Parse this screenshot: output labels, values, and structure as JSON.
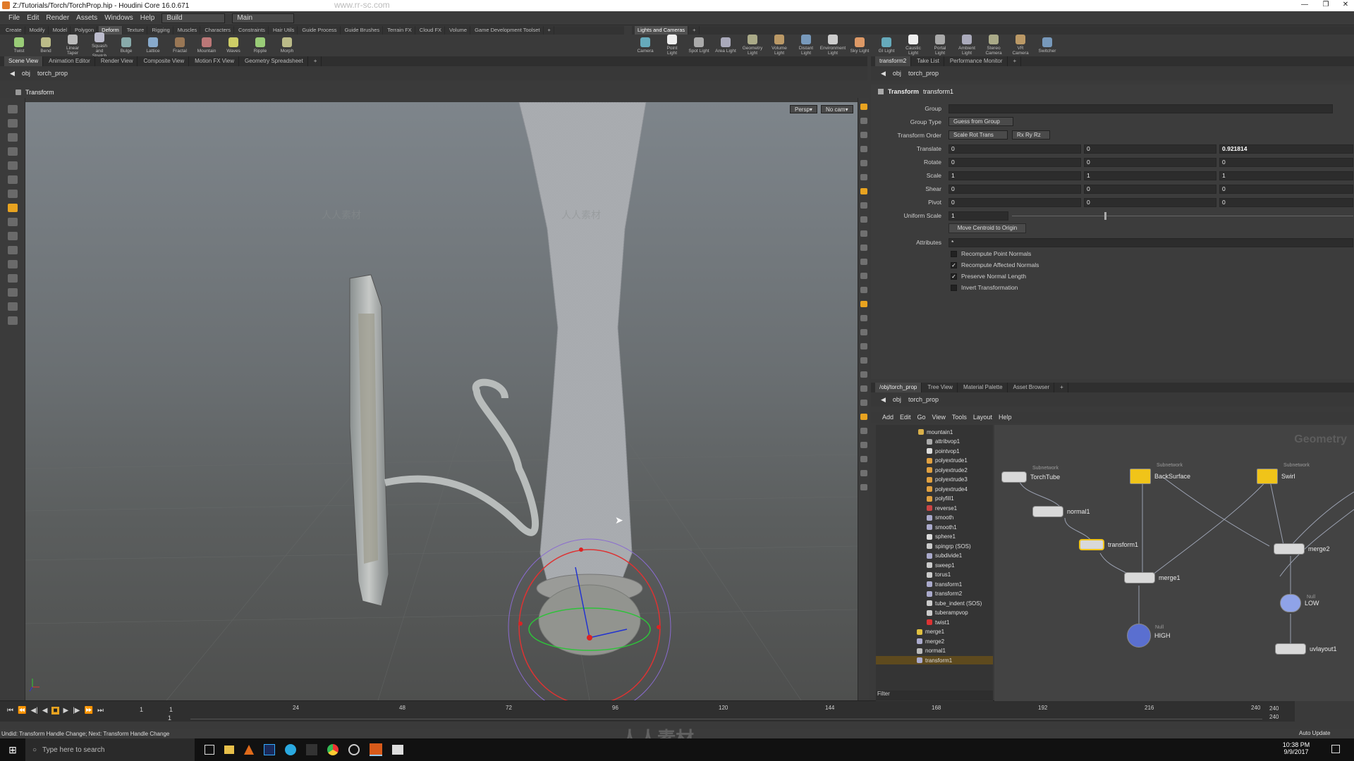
{
  "window": {
    "title": "Z:/Tutorials/Torch/TorchProp.hip - Houdini Core 16.0.671",
    "watermark": "www.rr-sc.com",
    "watermark2": "人人素材"
  },
  "menu": {
    "items": [
      "File",
      "Edit",
      "Render",
      "Assets",
      "Windows",
      "Help"
    ],
    "desktop": "Build",
    "pane_mode": "Main"
  },
  "shelf_tabs_left": [
    "Create",
    "Modify",
    "Model",
    "Polygon",
    "Deform",
    "Texture",
    "Rigging",
    "Muscles",
    "Characters",
    "Constraints",
    "Hair Utils",
    "Guide Process",
    "Guide Brushes",
    "Terrain FX",
    "Cloud FX",
    "Volume",
    "Game Development Toolset"
  ],
  "shelf_tabs_left_active": "Deform",
  "shelf_tools_left": [
    "Twist",
    "Bend",
    "Linear Taper",
    "Squash and Stretch",
    "Bulge",
    "Lattice",
    "Fractal",
    "Mountain",
    "Waves",
    "Ripple",
    "Morph"
  ],
  "shelf_tabs_right": [
    "Lights and Cameras"
  ],
  "shelf_tools_right": [
    "Camera",
    "Point Light",
    "Spot Light",
    "Area Light",
    "Geometry Light",
    "Volume Light",
    "Distant Light",
    "Environment Light",
    "Sky Light",
    "GI Light",
    "Caustic Light",
    "Portal Light",
    "Ambient Light",
    "Stereo Camera",
    "VR Camera",
    "Switcher"
  ],
  "viewport": {
    "tabs": [
      "Scene View",
      "Animation Editor",
      "Render View",
      "Composite View",
      "Motion FX View",
      "Geometry Spreadsheet"
    ],
    "path": {
      "obj": "obj",
      "node": "torch_prop"
    },
    "tool_label": "Transform",
    "persp": "Persp",
    "cam": "No cam"
  },
  "timeline": {
    "current": "1",
    "start": "1",
    "end": "240",
    "end2": "240",
    "start2": "1",
    "ticks": [
      "24",
      "48",
      "72",
      "96",
      "120",
      "144",
      "168",
      "192",
      "216",
      "240"
    ]
  },
  "status": "Undid: Transform Handle Change; Next: Transform Handle Change",
  "auto_update": "Auto Update",
  "params": {
    "tabs": [
      "transform2",
      "Take List",
      "Performance Monitor"
    ],
    "path": {
      "obj": "obj",
      "node": "torch_prop"
    },
    "node_type": "Transform",
    "node_name": "transform1",
    "group_label": "Group",
    "group_value": "",
    "group_type_label": "Group Type",
    "group_type_value": "Guess from Group",
    "order_label": "Transform Order",
    "order_value": "Scale Rot Trans",
    "rot_order": "Rx Ry Rz",
    "translate_label": "Translate",
    "translate": [
      "0",
      "0",
      "0.921814"
    ],
    "rotate_label": "Rotate",
    "rotate": [
      "0",
      "0",
      "0"
    ],
    "scale_label": "Scale",
    "scale": [
      "1",
      "1",
      "1"
    ],
    "shear_label": "Shear",
    "shear": [
      "0",
      "0",
      "0"
    ],
    "pivot_label": "Pivot",
    "pivot": [
      "0",
      "0",
      "0"
    ],
    "uniform_label": "Uniform Scale",
    "uniform_value": "1",
    "uniform_fraction": 0.27,
    "centroid_button": "Move Centroid to Origin",
    "attributes_label": "Attributes",
    "attributes_value": "*",
    "checks": [
      {
        "label": "Recompute Point Normals",
        "checked": false
      },
      {
        "label": "Recompute Affected Normals",
        "checked": true
      },
      {
        "label": "Preserve Normal Length",
        "checked": true
      },
      {
        "label": "Invert Transformation",
        "checked": false
      }
    ]
  },
  "network": {
    "tabs": [
      "/obj/torch_prop",
      "Tree View",
      "Material Palette",
      "Asset Browser"
    ],
    "path": {
      "obj": "obj",
      "node": "torch_prop"
    },
    "menu": [
      "Add",
      "Edit",
      "Go",
      "View",
      "Tools",
      "Layout",
      "Help"
    ],
    "context_label": "Geometry",
    "filter_label": "Filter",
    "tree": [
      "mountain1",
      "attribvop1",
      "pointvop1",
      "polyextrude1",
      "polyextrude2",
      "polyextrude3",
      "polyextrude4",
      "polyfill1",
      "reverse1",
      "smooth",
      "smooth1",
      "sphere1",
      "spingrp (SOS)",
      "subdivide1",
      "sweep1",
      "torus1",
      "transform1",
      "transform2",
      "tube_indent (SOS)",
      "tuberampvop",
      "twist1",
      "merge1",
      "merge2",
      "normal1",
      "transform1"
    ],
    "nodes": {
      "torchtube": "TorchTube",
      "torchtube_type": "Subnetwork",
      "backsurface": "BackSurface",
      "backsurface_type": "Subnetwork",
      "swirl": "Swirl",
      "swirl_type": "Subnetwork",
      "normal1": "normal1",
      "transform1": "transform1",
      "merge1": "merge1",
      "merge2": "merge2",
      "high": "HIGH",
      "high_type": "Null",
      "low": "LOW",
      "low_type": "Null",
      "uvlayout1": "uvlayout1"
    }
  },
  "taskbar": {
    "search": "Type here to search",
    "time": "10:38 PM",
    "date": "9/9/2017"
  },
  "colors": {
    "accent": "#e8a320",
    "selected_row": "#5e4a1e",
    "node_yellow": "#f0c419"
  }
}
